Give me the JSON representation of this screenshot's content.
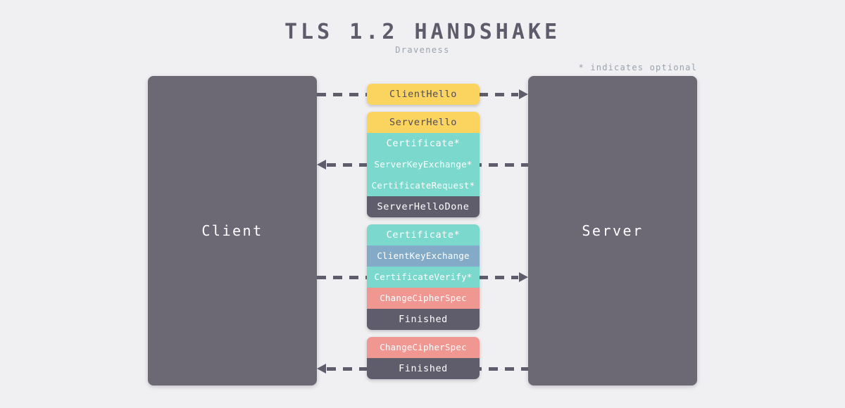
{
  "header": {
    "title": "TLS 1.2 HANDSHAKE",
    "subtitle": "Draveness",
    "note": "* indicates optional"
  },
  "endpoints": {
    "client": "Client",
    "server": "Server"
  },
  "colors": {
    "background": "#f0f0f2",
    "endpoint": "#6c6874",
    "dark": "#5f5c6b",
    "yellow": "#fad45f",
    "teal": "#7ad8cc",
    "blue": "#83aac6",
    "salmon": "#f09792",
    "title_text": "#5e5b6b",
    "muted_text": "#9aa3ad",
    "light_text": "#ffffff",
    "dark_text": "#4f4c5b"
  },
  "flows": [
    {
      "id": "flow-1",
      "direction": "client-to-server",
      "messages": [
        {
          "label": "ClientHello",
          "color": "#fad45f",
          "text_color": "#4f4c5b",
          "optional": false
        }
      ]
    },
    {
      "id": "flow-2",
      "direction": "server-to-client",
      "messages": [
        {
          "label": "ServerHello",
          "color": "#fad45f",
          "text_color": "#4f4c5b",
          "optional": false
        },
        {
          "label": "Certificate*",
          "color": "#7ad8cc",
          "text_color": "#ffffff",
          "optional": true
        },
        {
          "label": "ServerKeyExchange*",
          "color": "#7ad8cc",
          "text_color": "#ffffff",
          "optional": true
        },
        {
          "label": "CertificateRequest*",
          "color": "#7ad8cc",
          "text_color": "#ffffff",
          "optional": true
        },
        {
          "label": "ServerHelloDone",
          "color": "#5f5c6b",
          "text_color": "#ffffff",
          "optional": false
        }
      ]
    },
    {
      "id": "flow-3",
      "direction": "client-to-server",
      "messages": [
        {
          "label": "Certificate*",
          "color": "#7ad8cc",
          "text_color": "#ffffff",
          "optional": true
        },
        {
          "label": "ClientKeyExchange",
          "color": "#83aac6",
          "text_color": "#ffffff",
          "optional": false
        },
        {
          "label": "CertificateVerify*",
          "color": "#7ad8cc",
          "text_color": "#ffffff",
          "optional": true
        },
        {
          "label": "ChangeCipherSpec",
          "color": "#f09792",
          "text_color": "#ffffff",
          "optional": false
        },
        {
          "label": "Finished",
          "color": "#5f5c6b",
          "text_color": "#ffffff",
          "optional": false
        }
      ]
    },
    {
      "id": "flow-4",
      "direction": "server-to-client",
      "messages": [
        {
          "label": "ChangeCipherSpec",
          "color": "#f09792",
          "text_color": "#ffffff",
          "optional": false
        },
        {
          "label": "Finished",
          "color": "#5f5c6b",
          "text_color": "#ffffff",
          "optional": false
        }
      ]
    }
  ]
}
